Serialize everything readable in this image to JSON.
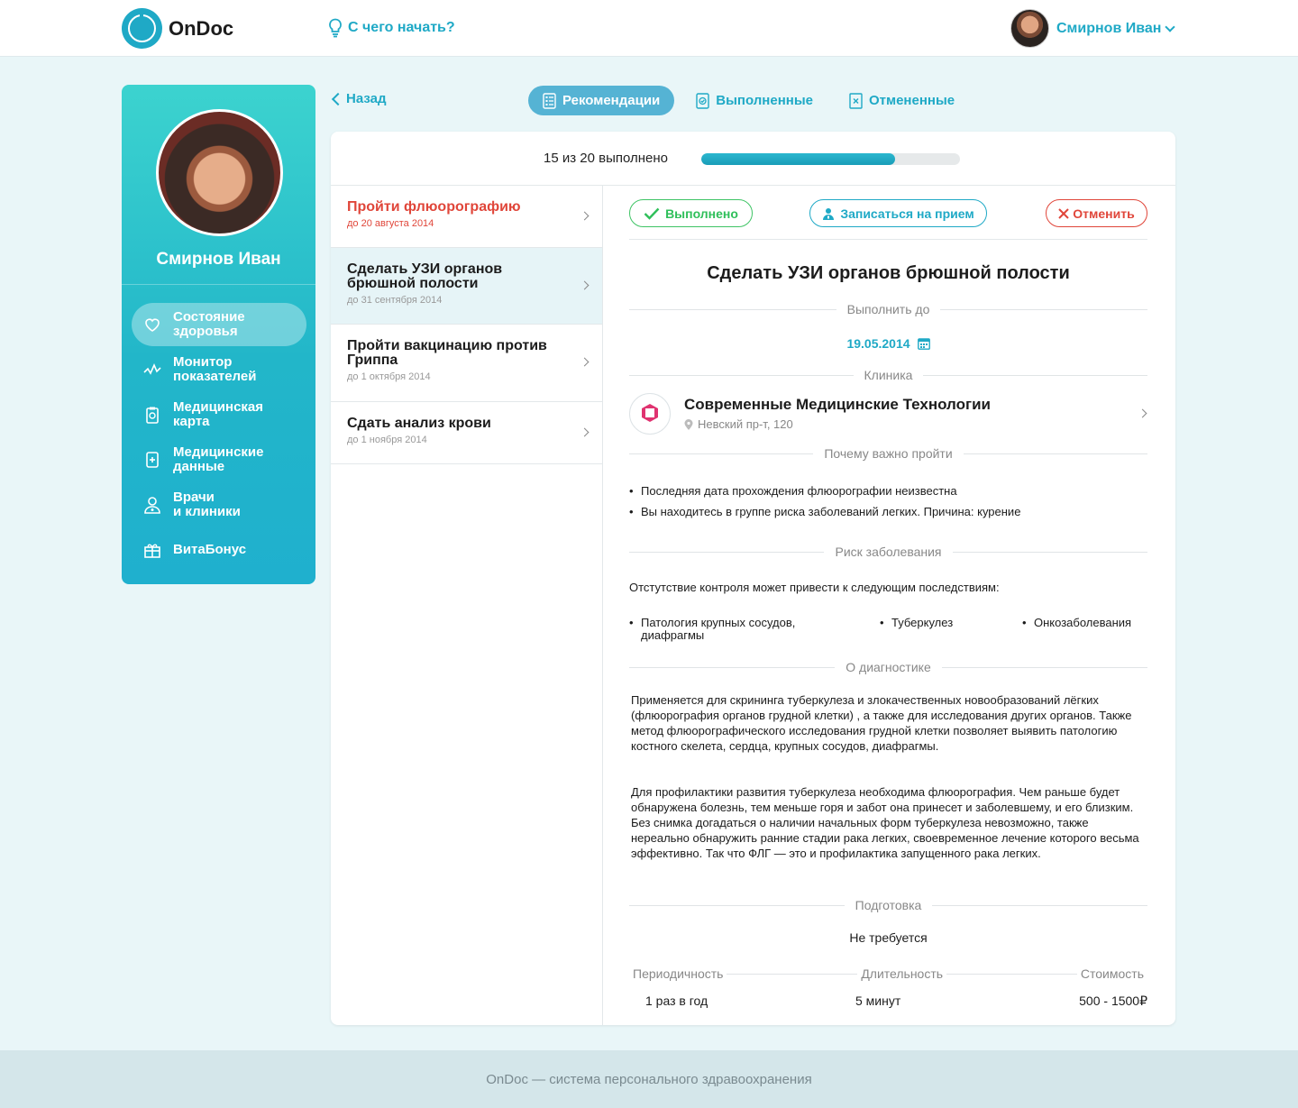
{
  "header": {
    "logo_text": "OnDoc",
    "start_link": "С чего начать?",
    "user_name": "Смирнов Иван"
  },
  "sidebar": {
    "name": "Смирнов Иван",
    "items": [
      {
        "label_1": "Состояние",
        "label_2": "здоровья",
        "icon": "heart-icon"
      },
      {
        "label_1": "Монитор",
        "label_2": "показателей",
        "icon": "pulse-icon"
      },
      {
        "label_1": "Медицинская",
        "label_2": "карта",
        "icon": "clipboard-icon"
      },
      {
        "label_1": "Медицинские",
        "label_2": "данные",
        "icon": "file-plus-icon"
      },
      {
        "label_1": "Врачи",
        "label_2": "и клиники",
        "icon": "doctor-icon"
      },
      {
        "label_1": "ВитаБонус",
        "label_2": "",
        "icon": "gift-icon"
      }
    ]
  },
  "nav": {
    "back": "Назад",
    "tabs": [
      "Рекомендации",
      "Выполненные",
      "Отмененные"
    ]
  },
  "progress": {
    "label": "15 из 20 выполнено",
    "done": 15,
    "total": 20
  },
  "list": [
    {
      "title": "Пройти флюорографию",
      "date": "до 20 августа 2014",
      "urgent": true
    },
    {
      "title": "Сделать УЗИ органов брюшной полости",
      "date": "до 31 сентября 2014",
      "active": true
    },
    {
      "title": "Пройти вакцинацию против Гриппа",
      "date": "до 1 октября 2014"
    },
    {
      "title": "Сдать анализ крови",
      "date": "до 1 ноября 2014"
    }
  ],
  "detail": {
    "actions": {
      "done": "Выполнено",
      "book": "Записаться на прием",
      "cancel": "Отменить"
    },
    "title": "Сделать УЗИ органов брюшной полости",
    "due_label": "Выполнить до",
    "due_date": "19.05.2014",
    "clinic_label": "Клиника",
    "clinic_name": "Современные Медицинские Технологии",
    "clinic_address": "Невский пр-т, 120",
    "why_label": "Почему важно пройти",
    "why_items": [
      "Последняя дата прохождения флюорографии  неизвестна",
      "Вы находитесь в группе риска заболеваний легких. Причина: курение"
    ],
    "risk_label": "Риск заболевания",
    "risk_intro": "Отстутствие контроля может привести к следующим последствиям:",
    "risks": [
      "Патология крупных сосудов, диафрагмы",
      "Туберкулез",
      "Онкозаболевания"
    ],
    "about_label": "О диагностике",
    "about_p1": "Применяется для скрининга туберкулеза и злокачественных новообразований лёгких (флюорография органов грудной клетки) , а также для исследования других органов. Также метод флюорографического исследования грудной клетки позволяет выявить патологию костного скелета, сердца, крупных сосудов, диафрагмы.",
    "about_p2": "Для профилактики развития туберкулеза необходима флюорография. Чем раньше будет обнаружена болезнь, тем меньше горя и забот она принесет и заболевшему, и его близким. Без снимка догадаться о наличии начальных форм туберкулеза невозможно, также нереально обнаружить ранние стадии рака легких, своевременное лечение которого весьма эффективно. Так что ФЛГ — это и профилактика запущенного рака легких.",
    "prep_label": "Подготовка",
    "prep_value": "Не требуется",
    "periodicity_label": "Периодичность",
    "periodicity_value": "1 раз в год",
    "duration_label": "Длительность",
    "duration_value": "5 минут",
    "cost_label": "Стоимость",
    "cost_value": "500 - 1500₽"
  },
  "footer": {
    "text": "OnDoc — система персонального здравоохранения"
  },
  "colors": {
    "accent": "#1fa9c6",
    "success": "#3fc465",
    "danger": "#e0463a"
  }
}
